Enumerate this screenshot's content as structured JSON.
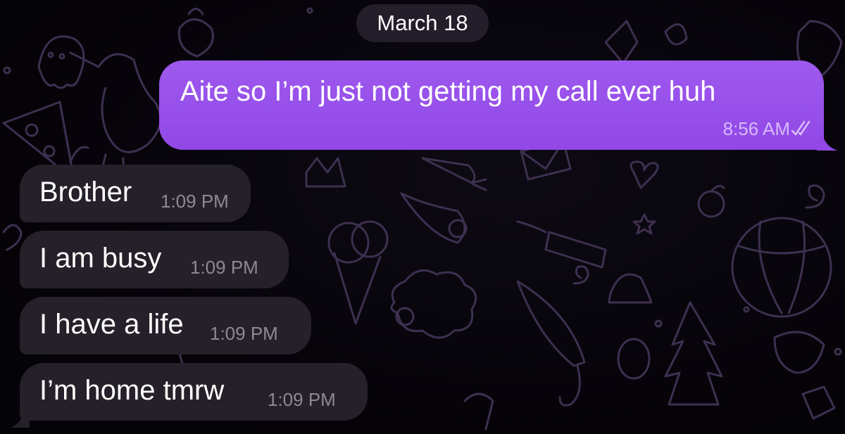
{
  "date_separator": "March 18",
  "outgoing_message": {
    "text": "Aite so I’m just not getting my call ever huh",
    "time": "8:56 AM",
    "status_icon": "double-check-icon",
    "bubble_color": "#9a52ec"
  },
  "incoming_messages": [
    {
      "text": "Brother",
      "time": "1:09 PM"
    },
    {
      "text": "I am busy",
      "time": "1:09 PM"
    },
    {
      "text": "I have a life",
      "time": "1:09 PM"
    },
    {
      "text": "I’m home tmrw",
      "time": "1:09 PM"
    }
  ],
  "colors": {
    "background": "#060409",
    "incoming_bubble": "#252029",
    "doodle_stroke": "#3b2f4c"
  }
}
